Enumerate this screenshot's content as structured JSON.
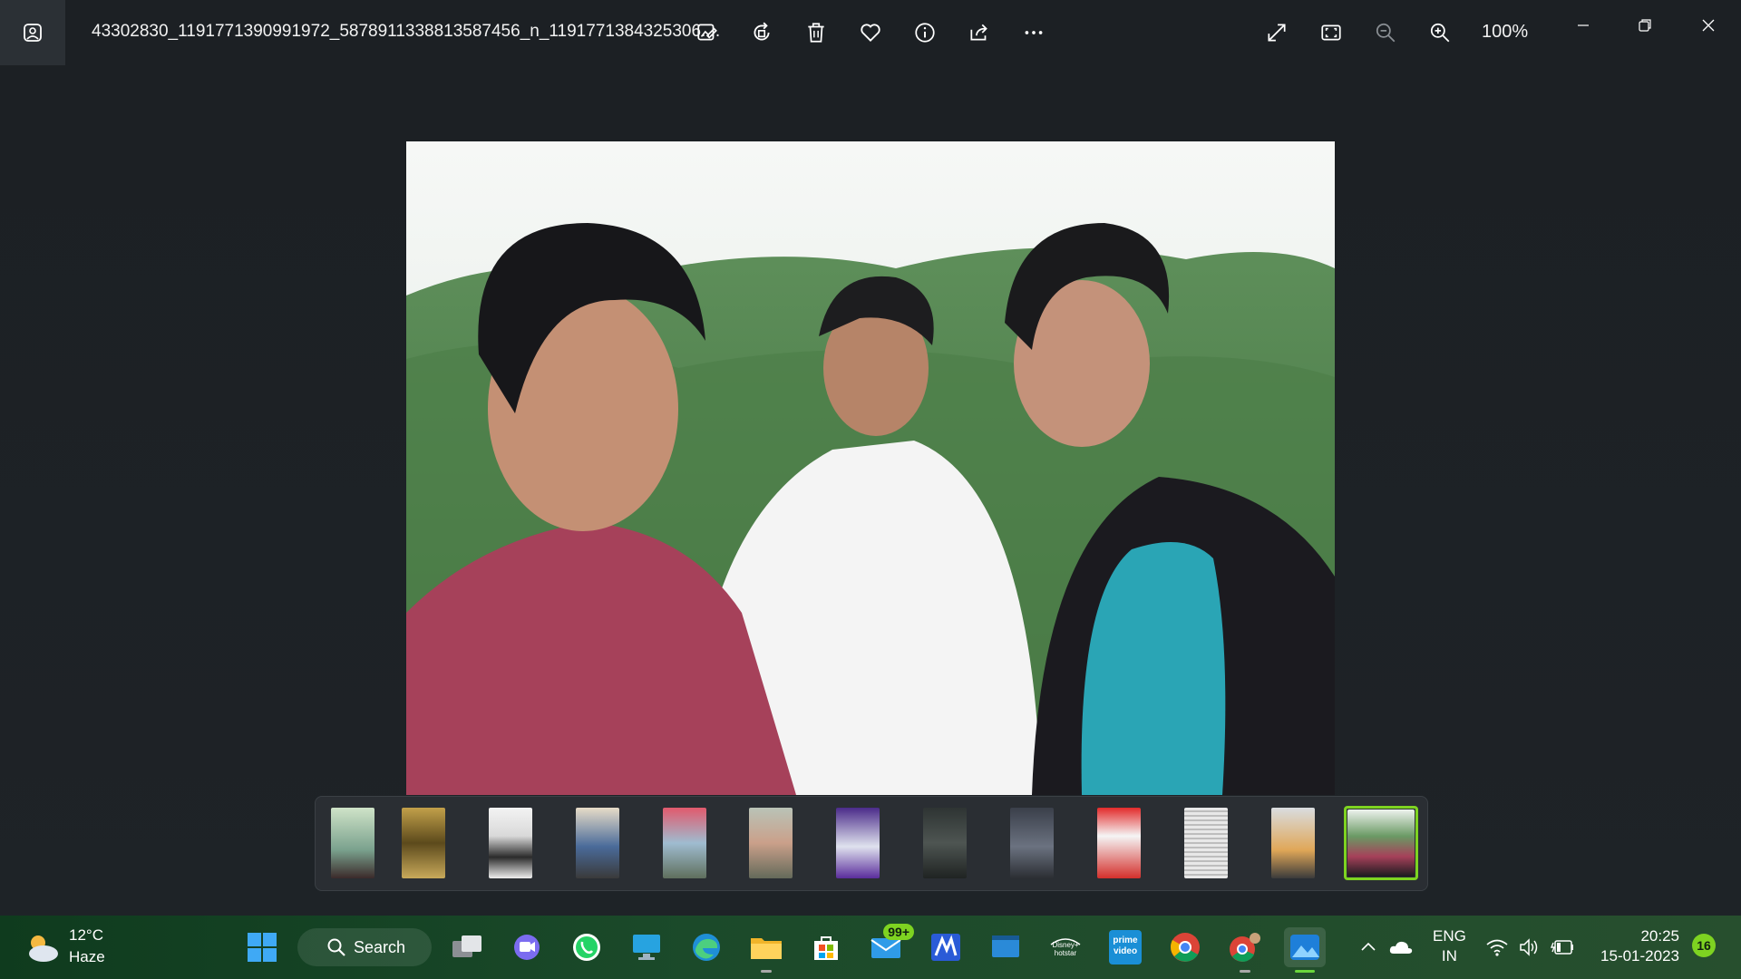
{
  "window": {
    "file_name": "43302830_1191771390991972_5878911338813587456_n_1191771384325306....",
    "zoom": "100%"
  },
  "toolbar": {
    "icons": [
      "edit-image-icon",
      "rotate-icon",
      "delete-icon",
      "favorite-icon",
      "info-icon",
      "share-icon",
      "more-icon"
    ],
    "view_icons": [
      "fullscreen-icon",
      "fit-icon",
      "zoom-out-icon",
      "zoom-in-icon"
    ]
  },
  "filmstrip": {
    "count": 13,
    "selected_index": 12
  },
  "taskbar": {
    "weather": {
      "temp": "12°C",
      "condition": "Haze"
    },
    "search_label": "Search",
    "mail_badge": "99+",
    "hotstar_label": "Disney+ hotstar",
    "prime_label": "prime video",
    "lang_line1": "ENG",
    "lang_line2": "IN",
    "time": "20:25",
    "date": "15-01-2023",
    "notifications": "16"
  },
  "colors": {
    "accent": "#7ed321",
    "background": "#1e2226"
  }
}
